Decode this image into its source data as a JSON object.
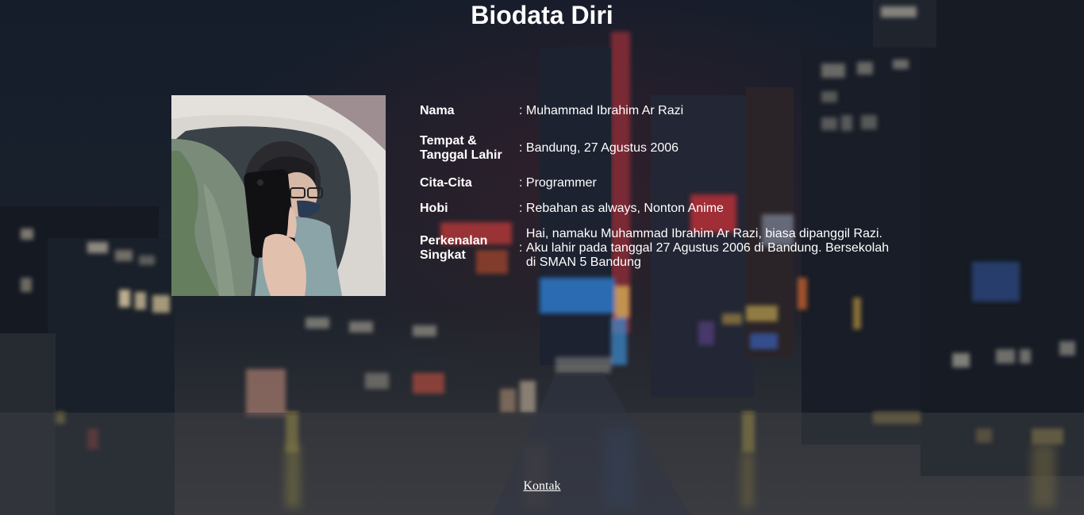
{
  "page": {
    "title": "Biodata Diri"
  },
  "biodata": [
    {
      "label": "Nama",
      "value": "Muhammad Ibrahim Ar Razi"
    },
    {
      "label": "Tempat & Tanggal Lahir",
      "value": "Bandung, 27 Agustus 2006"
    },
    {
      "label": "Cita-Cita",
      "value": "Programmer"
    },
    {
      "label": "Hobi",
      "value": "Rebahan as always, Nonton Anime"
    },
    {
      "label": "Perkenalan Singkat",
      "value": "Hai, namaku Muhammad Ibrahim Ar Razi, biasa dipanggil Razi. Aku lahir pada tanggal 27 Agustus 2006 di Bandung. Bersekolah di SMAN 5 Bandung"
    }
  ],
  "separator": ": ",
  "footer": {
    "contact_link": "Kontak"
  },
  "colors": {
    "text": "#ffffff",
    "background": "#141a24"
  }
}
